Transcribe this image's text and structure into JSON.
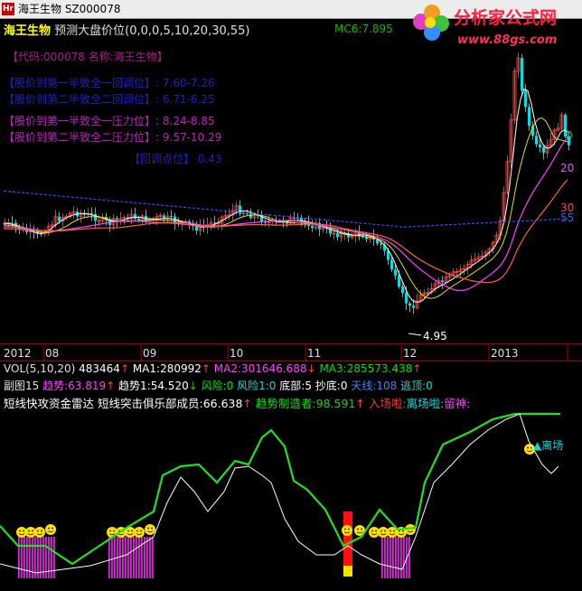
{
  "window": {
    "title": "海王生物 SZ000078"
  },
  "logo": {
    "brand": "分析家公式网",
    "url": "www.88gs.com"
  },
  "main_chart": {
    "stock_name": "海王生物",
    "indicator_title": "预测大盘价位",
    "params": "(0,0,0,5,10,20,30,55)",
    "mc6_label": "MC6:7.895",
    "ma_labels": [
      "0",
      "20",
      "30",
      "55"
    ],
    "code_line": "【代码:000078 名称:海王生物】",
    "lines": [
      {
        "label": "【股价到第一半致全一回调位】",
        "value": ": 7.60-7.26"
      },
      {
        "label": "【股价到第二半致全二回调位】",
        "value": ": 6.71-6.25"
      },
      {
        "label": "【股价到第一半致全一压力位】",
        "value": ": 8.24-8.85"
      },
      {
        "label": "【股价到第二半致全二压力位】",
        "value": ": 9.57-10.29"
      }
    ],
    "pullback_label": "【回调点位】",
    "pullback_value": " 0.43",
    "low_label": "4.95",
    "time_axis": [
      "2012",
      "08",
      "09",
      "10",
      "11",
      "12",
      "2013"
    ],
    "colors": {
      "up": "#ff3030",
      "down": "#00e0e0",
      "ma5": "#ffffff",
      "ma10": "#e0e000",
      "ma20": "#ff40ff",
      "ma30": "#ff6040",
      "ma55": "#3050ff"
    }
  },
  "vol_bar": {
    "label": "VOL(5,10,20)",
    "vol": "483464",
    "ma1": "MA1:280992",
    "ma2": "MA2:301646.688",
    "ma3": "MA3:285573.438"
  },
  "sub_chart": {
    "line1": {
      "prefix": "副图15",
      "trend_a": "趋势:63.819",
      "trend_b": "趋势1:54.520",
      "risk": "风险:0",
      "risk1": "风险1:0",
      "bottom": "底部:5",
      "chaodi": "抄底:0",
      "tianxian": "天线:108",
      "taoding": "逃顶:0"
    },
    "line2": {
      "radar": "短线快攻资金雷达",
      "club": "短线突击俱乐部成员:66.638",
      "maker": "趋势制造者:98.591",
      "enter": "入场啦:",
      "leave": "离场啦:",
      "keep": "留神:"
    },
    "leave_marker": "离场"
  }
}
